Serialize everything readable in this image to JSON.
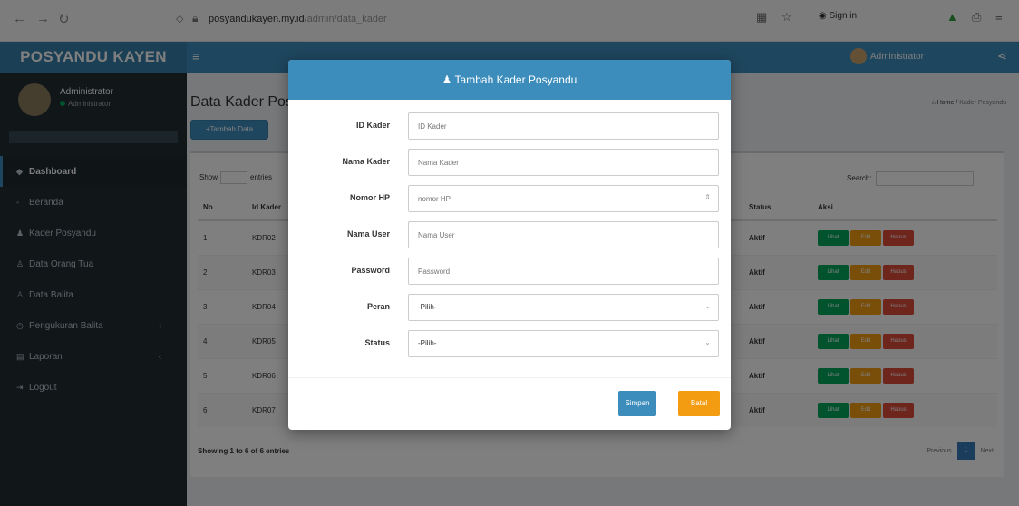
{
  "browser": {
    "url_host": "posyandukayen.my.id",
    "url_path": "/admin/data_kader",
    "signin_label": "Sign in"
  },
  "app": {
    "logo": "POSYANDU KAYEN",
    "user_name": "Administrator"
  },
  "sidebar": {
    "user_name": "Administrator",
    "user_status": "Administrator",
    "items": [
      {
        "label": "Dashboard",
        "icon": "dashboard-icon"
      },
      {
        "label": "Beranda",
        "icon": "home-icon"
      },
      {
        "label": "Kader Posyandu",
        "icon": "users-icon"
      },
      {
        "label": "Data Orang Tua",
        "icon": "user-icon"
      },
      {
        "label": "Data Balita",
        "icon": "child-icon"
      },
      {
        "label": "Pengukuran Balita",
        "icon": "ruler-icon"
      },
      {
        "label": "Laporan",
        "icon": "report-icon"
      },
      {
        "label": "Logout",
        "icon": "logout-icon"
      }
    ]
  },
  "page": {
    "title": "Data Kader Posyandu",
    "breadcrumb_home": "Home",
    "breadcrumb_current": "Kader Posyandu",
    "add_button": "Tambah Data",
    "show_label": "Show",
    "entries_label": "entries",
    "search_label": "Search:",
    "showing": "Showing 1 to 6 of 6 entries",
    "prev": "Previous",
    "page_num": "1",
    "next": "Next"
  },
  "table": {
    "headers": [
      "No",
      "Id Kader",
      "Status",
      "Aksi"
    ],
    "rows": [
      {
        "no": "1",
        "id": "KDR02",
        "status": "Aktif"
      },
      {
        "no": "2",
        "id": "KDR03",
        "status": "Aktif"
      },
      {
        "no": "3",
        "id": "KDR04",
        "status": "Aktif"
      },
      {
        "no": "4",
        "id": "KDR05",
        "status": "Aktif"
      },
      {
        "no": "5",
        "id": "KDR06",
        "status": "Aktif"
      },
      {
        "no": "6",
        "id": "KDR07",
        "status": "Aktif"
      }
    ],
    "actions": {
      "view": "Lihat",
      "edit": "Edit",
      "delete": "Hapus"
    }
  },
  "modal": {
    "title": "Tambah Kader Posyandu",
    "fields": [
      {
        "label": "ID Kader",
        "placeholder": "ID Kader"
      },
      {
        "label": "Nama Kader",
        "placeholder": "Nama Kader"
      },
      {
        "label": "Nomor HP",
        "placeholder": "nomor HP"
      },
      {
        "label": "Nama User",
        "placeholder": "Nama User"
      },
      {
        "label": "Password",
        "placeholder": "Password"
      },
      {
        "label": "Peran",
        "value": "-Pilih-"
      },
      {
        "label": "Status",
        "value": "-Pilih-"
      }
    ],
    "save": "Simpan",
    "cancel": "Batal"
  },
  "colors": {
    "primary": "#3c8dbc",
    "sidebar": "#222d32",
    "success": "#00a65a",
    "warning": "#f39c12",
    "danger": "#dd4b39"
  }
}
